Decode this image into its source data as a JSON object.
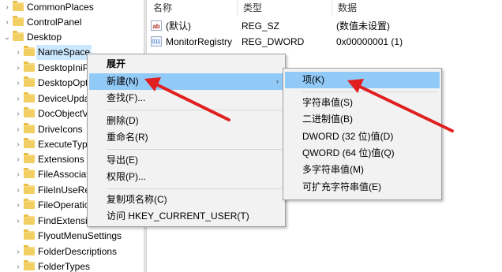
{
  "tree": {
    "items": [
      {
        "label": "CommonPlaces",
        "chevron": "›"
      },
      {
        "label": "ControlPanel",
        "chevron": "›"
      },
      {
        "label": "Desktop",
        "chevron": "⌄"
      },
      {
        "label": "NameSpace",
        "chevron": "›"
      },
      {
        "label": "DesktopIniPro",
        "chevron": "›"
      },
      {
        "label": "DesktopOptio",
        "chevron": "›"
      },
      {
        "label": "DeviceUpdate",
        "chevron": "›"
      },
      {
        "label": "DocObjectVie",
        "chevron": "›"
      },
      {
        "label": "DriveIcons",
        "chevron": "›"
      },
      {
        "label": "ExecuteTypeD",
        "chevron": "›"
      },
      {
        "label": "Extensions",
        "chevron": "›"
      },
      {
        "label": "FileAssociatio",
        "chevron": "›"
      },
      {
        "label": "FileInUseReso",
        "chevron": "›"
      },
      {
        "label": "FileOperation",
        "chevron": "›"
      },
      {
        "label": "FindExtension",
        "chevron": "›"
      },
      {
        "label": "FlyoutMenuSettings",
        "chevron": ""
      },
      {
        "label": "FolderDescriptions",
        "chevron": "›"
      },
      {
        "label": "FolderTypes",
        "chevron": "›"
      }
    ]
  },
  "values_pane": {
    "headers": {
      "name": "名称",
      "type": "类型",
      "data": "数据"
    },
    "rows": [
      {
        "icon": "string-value-icon",
        "icon_text": "ab",
        "name": "(默认)",
        "type": "REG_SZ",
        "data": "(数值未设置)"
      },
      {
        "icon": "dword-value-icon",
        "icon_text": "011",
        "name": "MonitorRegistry",
        "type": "REG_DWORD",
        "data": "0x00000001 (1)"
      }
    ]
  },
  "context_menu": {
    "items": [
      {
        "label": "展开",
        "bold": true
      },
      {
        "label": "新建(N)",
        "submenu": true,
        "highlighted": true
      },
      {
        "label": "查找(F)..."
      },
      {
        "label": "删除(D)"
      },
      {
        "label": "重命名(R)"
      },
      {
        "label": "导出(E)"
      },
      {
        "label": "权限(P)..."
      },
      {
        "label": "复制项名称(C)"
      },
      {
        "label": "访问 HKEY_CURRENT_USER(T)"
      }
    ],
    "submenu_arrow": "›"
  },
  "new_submenu": {
    "items": [
      {
        "label": "项(K)",
        "highlighted": true
      },
      {
        "label": "字符串值(S)"
      },
      {
        "label": "二进制值(B)"
      },
      {
        "label": "DWORD (32 位)值(D)"
      },
      {
        "label": "QWORD (64 位)值(Q)"
      },
      {
        "label": "多字符串值(M)"
      },
      {
        "label": "可扩充字符串值(E)"
      }
    ]
  },
  "colors": {
    "highlight": "#91c9f7",
    "arrow": "#e02020",
    "folder": "#f2cf63"
  }
}
